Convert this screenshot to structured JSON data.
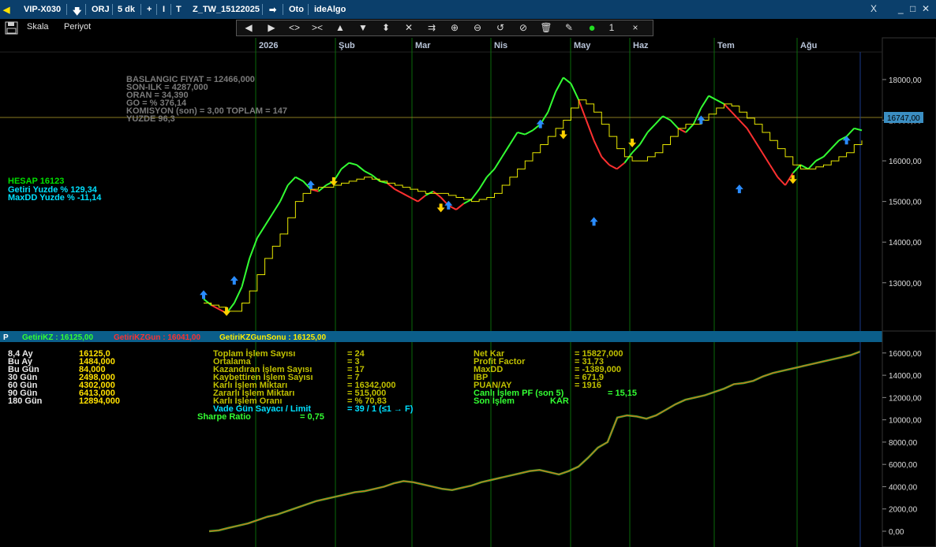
{
  "titlebar": {
    "symbol": "VIP-X030",
    "down_arrow": "🡇",
    "mode": "ORJ",
    "period": "5 dk",
    "plus": "+",
    "bar_icon": "I",
    "t_icon": "T",
    "template": "Z_TW_15122025",
    "right_arrow": "➡",
    "auto": "Oto",
    "ide": "ideAlgo",
    "close_x": "X",
    "minimize": "_",
    "maximize": "□",
    "close": "✕"
  },
  "toolbar": {
    "save_icon": "floppy-disk-icon",
    "scale_label": "Skala",
    "period_label": "Periyot"
  },
  "drawing_tools": [
    "arrow-left-icon",
    "arrow-right-icon",
    "expand-h-icon",
    "shrink-h-icon",
    "arrow-up-icon",
    "arrow-down-icon",
    "expand-v-icon",
    "shrink-v-icon",
    "fit-icon",
    "zoom-in-icon",
    "zoom-out-icon",
    "refresh-icon",
    "no-icon",
    "trash-icon",
    "pen-icon",
    "dot-green-icon"
  ],
  "drawbar": {
    "count": "1",
    "close": "×"
  },
  "months": [
    "2026",
    "Şub",
    "Mar",
    "Nis",
    "May",
    "Haz",
    "Tem",
    "Ağu"
  ],
  "info_lines": [
    "BASLANGIC FIYAT = 12466,000",
    "SON-ILK = 4287,000",
    "ORAN = 34,390",
    "GO = %  376,14",
    "KOMISYON (son) =    3,00   TOPLAM = 147",
    "YUZDE   96,3"
  ],
  "account": {
    "hesap": "HESAP   16123",
    "getiri": "Getiri Yuzde  % 129,34",
    "maxdd": "MaxDD Yuzde   % -11,14"
  },
  "price_axis": [
    "18000,00",
    "17000,00",
    "16000,00",
    "15000,00",
    "14000,00",
    "13000,00"
  ],
  "current_price": "16747,00",
  "lower_header": {
    "p": "P",
    "g1": "GetiriKZ :  16125,00",
    "g2": "GetiriKZGun :  16041,00",
    "g3": "GetiriKZGunSonu :  16125,00"
  },
  "equity_axis": [
    "16000,00",
    "14000,00",
    "12000,00",
    "10000,00",
    "8000,00",
    "6000,00",
    "4000,00",
    "2000,00",
    "0,00"
  ],
  "period_stats": [
    [
      "8,4 Ay",
      "16125,0"
    ],
    [
      "Bu Ay",
      "1484,000"
    ],
    [
      "Bu Gün",
      "84,000"
    ],
    [
      "30 Gün",
      "2498,000"
    ],
    [
      "60 Gün",
      "4302,000"
    ],
    [
      "90 Gün",
      "6413,000"
    ],
    [
      "180 Gün",
      "12894,000"
    ]
  ],
  "trade_stats": [
    [
      "Toplam İşlem Sayısı",
      "= 24"
    ],
    [
      "Ortalama",
      "= 3"
    ],
    [
      "Kazandıran İşlem Sayısı",
      "= 17"
    ],
    [
      "Kaybettiren İşlem Sayısı",
      "= 7"
    ],
    [
      "Karlı İşlem Miktarı",
      "= 16342,000"
    ],
    [
      "Zararlı İşlem Miktarı",
      "= 515,000"
    ],
    [
      "Karlı İşlem Oranı",
      "= % 70,83"
    ],
    [
      "Vade Gün Sayacı / Limit",
      "= 39 / 1   (≤1 → F)"
    ]
  ],
  "sharpe": [
    "Sharpe Ratio",
    "=    0,75"
  ],
  "perf_stats": [
    [
      "Net Kar",
      "= 15827,000"
    ],
    [
      "Profit Factor",
      "= 31,73"
    ],
    [
      "MaxDD",
      "= -1389,000"
    ],
    [
      "IBP",
      "= 671,9"
    ],
    [
      "PUAN/AY",
      "= 1916"
    ]
  ],
  "pf_line": [
    "Canlı İşlem PF (son 5)",
    "= 15,15"
  ],
  "last_trade": [
    "Son İşlem",
    "KAR"
  ],
  "chart_data": [
    {
      "type": "line",
      "title": "",
      "ylim": [
        12200,
        18600
      ],
      "x_labels": [
        "2026",
        "Şub",
        "Mar",
        "Nis",
        "May",
        "Haz",
        "Tem",
        "Ağu"
      ],
      "series": [
        {
          "values": [
            12600,
            12450,
            12350,
            12250,
            12500,
            12900,
            13600,
            14100,
            14400,
            14700,
            15000,
            15400,
            15600,
            15500,
            15300,
            15250,
            15400,
            15500,
            15800,
            15950,
            15900,
            15750,
            15650,
            15500,
            15450,
            15300,
            15200,
            15100,
            15000,
            15150,
            15250,
            15100,
            14900,
            14800,
            14950,
            15050,
            15300,
            15600,
            15800,
            16100,
            16400,
            16700,
            16650,
            16750,
            16900,
            17200,
            17700,
            18050,
            17900,
            17500,
            17000,
            16500,
            16100,
            15900,
            15800,
            15950,
            16200,
            16400,
            16700,
            16900,
            17100,
            17000,
            16800,
            16700,
            16900,
            17300,
            17600,
            17500,
            17400,
            17200,
            17000,
            16800,
            16500,
            16200,
            15900,
            15600,
            15400,
            15700,
            15900,
            15800,
            16000,
            16100,
            16300,
            16500,
            16600,
            16800,
            16750
          ]
        },
        {
          "values": [
            12500,
            12450,
            12400,
            12300,
            12300,
            12500,
            12800,
            13200,
            13600,
            13900,
            14200,
            14600,
            15000,
            15200,
            15300,
            15350,
            15350,
            15400,
            15450,
            15500,
            15550,
            15600,
            15550,
            15500,
            15450,
            15400,
            15350,
            15300,
            15250,
            15200,
            15200,
            15200,
            15150,
            15100,
            15050,
            15000,
            15050,
            15100,
            15200,
            15400,
            15600,
            15800,
            16000,
            16200,
            16400,
            16600,
            16800,
            17000,
            17300,
            17500,
            17400,
            17200,
            16900,
            16600,
            16300,
            16100,
            16000,
            16000,
            16100,
            16200,
            16400,
            16600,
            16800,
            16900,
            16900,
            17000,
            17150,
            17300,
            17400,
            17350,
            17200,
            17050,
            16900,
            16700,
            16500,
            16300,
            16100,
            15900,
            15800,
            15800,
            15850,
            15900,
            16000,
            16100,
            16200,
            16400,
            16500
          ]
        }
      ],
      "markers": [
        {
          "type": "long",
          "value": 12700
        },
        {
          "type": "long",
          "value": 13050
        },
        {
          "type": "short",
          "value": 12300
        },
        {
          "type": "long",
          "value": 15400
        },
        {
          "type": "short",
          "value": 15500
        },
        {
          "type": "long",
          "value": 14900
        },
        {
          "type": "short",
          "value": 14850
        },
        {
          "type": "long",
          "value": 16900
        },
        {
          "type": "short",
          "value": 16650
        },
        {
          "type": "long",
          "value": 14500
        },
        {
          "type": "short",
          "value": 16450
        },
        {
          "type": "long",
          "value": 17000
        },
        {
          "type": "long",
          "value": 15300
        },
        {
          "type": "short",
          "value": 15550
        },
        {
          "type": "long",
          "value": 16500
        }
      ]
    },
    {
      "type": "area",
      "title": "",
      "ylim": [
        0,
        16200
      ],
      "series": [
        {
          "name": "GetiriKZ",
          "values": [
            0,
            80,
            300,
            500,
            700,
            1000,
            1300,
            1500,
            1800,
            2100,
            2400,
            2700,
            2900,
            3100,
            3300,
            3500,
            3600,
            3800,
            4000,
            4300,
            4500,
            4400,
            4200,
            4000,
            3800,
            3700,
            3900,
            4100,
            4400,
            4600,
            4800,
            5000,
            5200,
            5400,
            5500,
            5300,
            5100,
            5400,
            5800,
            6600,
            7500,
            8000,
            10200,
            10400,
            10300,
            10100,
            10400,
            10900,
            11400,
            11800,
            12000,
            12200,
            12500,
            12800,
            13200,
            13300,
            13500,
            13900,
            14200,
            14400,
            14600,
            14800,
            15000,
            15200,
            15400,
            15600,
            15800,
            16125
          ]
        }
      ]
    }
  ]
}
